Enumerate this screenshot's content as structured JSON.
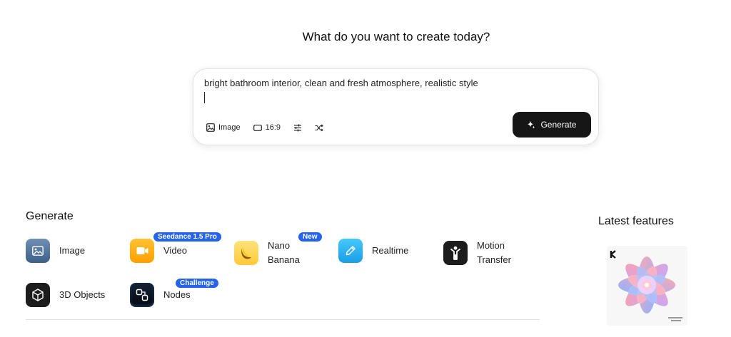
{
  "headline": "What do you want to create today?",
  "prompt": {
    "text": "bright bathroom interior, clean and fresh atmosphere, realistic style",
    "tools": {
      "image_label": "Image",
      "ratio_label": "16:9"
    },
    "generate_label": "Generate"
  },
  "generate_section": {
    "title": "Generate",
    "items": [
      {
        "label": "Image",
        "badge": "",
        "icon": "image-icon",
        "color": "#5b7fa8"
      },
      {
        "label": "Video",
        "badge": "Seedance 1.5 Pro",
        "icon": "video-camera-icon",
        "color": "#ffb400"
      },
      {
        "label_line1": "Nano",
        "label_line2": "Banana",
        "badge": "New",
        "icon": "banana-icon",
        "color": "#ffd54a"
      },
      {
        "label": "Realtime",
        "badge": "",
        "icon": "pen-icon",
        "color": "#2cb6f0"
      },
      {
        "label_line1": "Motion",
        "label_line2": "Transfer",
        "badge": "",
        "icon": "person-icon",
        "color": "#1c1c1c"
      },
      {
        "label": "3D Objects",
        "badge": "",
        "icon": "cube-icon",
        "color": "#1c1c1c"
      },
      {
        "label": "Nodes",
        "badge": "Challenge",
        "icon": "nodes-icon",
        "color": "#0c1424"
      }
    ]
  },
  "latest_features": {
    "title": "Latest features"
  }
}
